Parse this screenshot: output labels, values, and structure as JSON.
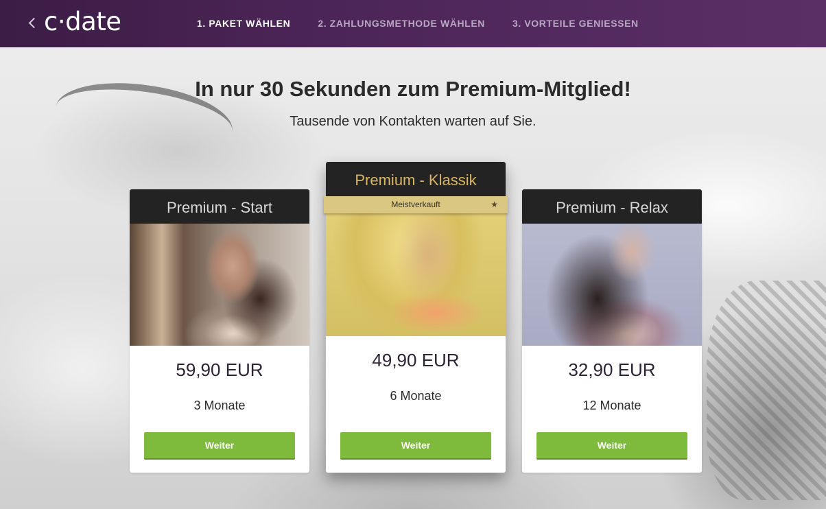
{
  "header": {
    "brand": "c·date",
    "steps": [
      {
        "label": "1. PAKET WÄHLEN",
        "active": true
      },
      {
        "label": "2. ZAHLUNGSMETHODE WÄHLEN",
        "active": false
      },
      {
        "label": "3. VORTEILE GENIESSEN",
        "active": false
      }
    ]
  },
  "intro": {
    "title": "In nur 30 Sekunden zum Premium-Mitglied!",
    "subtitle": "Tausende von Kontakten warten auf Sie."
  },
  "plans": [
    {
      "name": "Premium - Start",
      "price": "59,90 EUR",
      "term": "3 Monate",
      "button": "Weiter",
      "featured": false
    },
    {
      "name": "Premium - Klassik",
      "price": "49,90 EUR",
      "term": "6 Monate",
      "button": "Weiter",
      "featured": true,
      "badge": "Meistverkauft",
      "badge_icon": "star-icon"
    },
    {
      "name": "Premium - Relax",
      "price": "32,90 EUR",
      "term": "12 Monate",
      "button": "Weiter",
      "featured": false
    }
  ],
  "colors": {
    "header_bg": "#4c2558",
    "button_green": "#7eba3b",
    "featured_title": "#d8b760",
    "badge_bg": "#d9c782"
  }
}
